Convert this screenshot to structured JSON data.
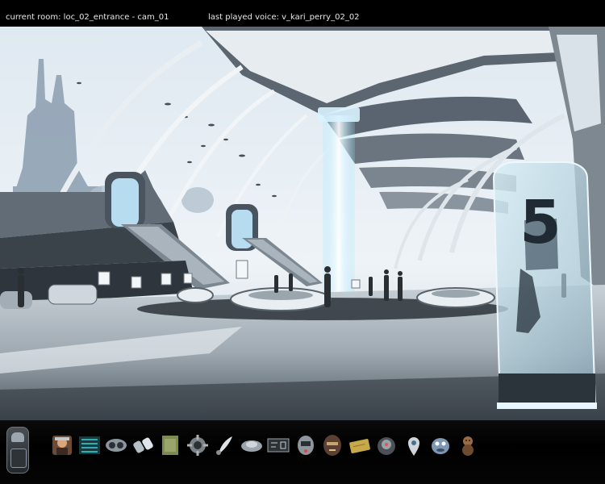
{
  "hud": {
    "current_room": "current room: loc_02_entrance - cam_01",
    "last_voice": "last played voice: v_kari_perry_02_02"
  },
  "scene": {
    "sign_number": "5"
  },
  "inventory": {
    "items": [
      {
        "icon": "helmet-portrait-icon"
      },
      {
        "icon": "circuit-board-icon"
      },
      {
        "icon": "goggles-icon"
      },
      {
        "icon": "ring-parts-icon"
      },
      {
        "icon": "notebook-icon"
      },
      {
        "icon": "gear-device-icon"
      },
      {
        "icon": "feather-pen-icon"
      },
      {
        "icon": "disc-device-icon"
      },
      {
        "icon": "control-panel-icon"
      },
      {
        "icon": "robot-head-icon"
      },
      {
        "icon": "mask-icon"
      },
      {
        "icon": "gold-card-icon"
      },
      {
        "icon": "round-gadget-icon"
      },
      {
        "icon": "location-pin-icon"
      },
      {
        "icon": "creature-icon"
      },
      {
        "icon": "doll-icon"
      }
    ]
  }
}
